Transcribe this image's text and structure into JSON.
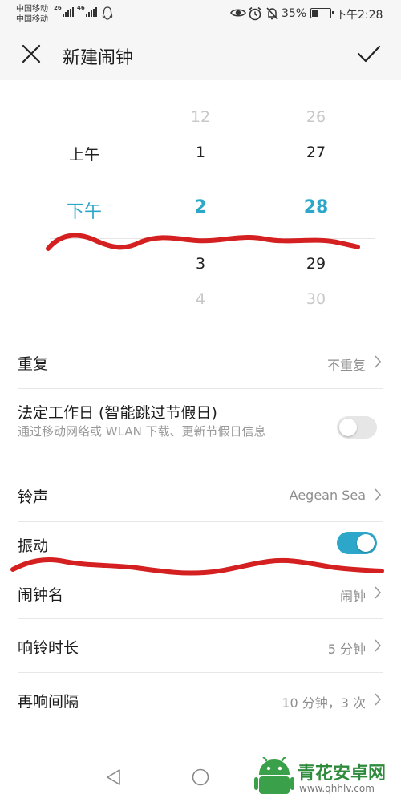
{
  "status_bar": {
    "carrier1": "中国移动",
    "carrier2": "中国移动",
    "net1": "26",
    "net2": "46",
    "battery_percent": "35%",
    "battery_level": 0.35,
    "time": "下午2:28",
    "icons": [
      "signal-icon",
      "qq-icon",
      "eye-icon",
      "alarm-icon",
      "mute-icon",
      "battery-icon"
    ]
  },
  "header": {
    "title": "新建闹钟",
    "close_icon": "close-icon",
    "confirm_icon": "check-icon"
  },
  "time_picker": {
    "period_column": {
      "above": "上午",
      "selected": "下午"
    },
    "hour_column": {
      "above2": "12",
      "above1": "1",
      "selected": "2",
      "below1": "3",
      "below2": "4"
    },
    "minute_column": {
      "above2": "26",
      "above1": "27",
      "selected": "28",
      "below1": "29",
      "below2": "30"
    }
  },
  "settings": {
    "repeat": {
      "label": "重复",
      "value": "不重复"
    },
    "workday": {
      "label": "法定工作日 (智能跳过节假日)",
      "subtitle": "通过移动网络或 WLAN 下载、更新节假日信息",
      "enabled": false
    },
    "ringtone": {
      "label": "铃声",
      "value": "Aegean Sea"
    },
    "vibrate": {
      "label": "振动",
      "enabled": true
    },
    "alarm_name": {
      "label": "闹钟名",
      "value": "闹钟"
    },
    "ring_duration": {
      "label": "响铃时长",
      "value": "5 分钟"
    },
    "snooze_interval": {
      "label": "再响间隔",
      "value": "10 分钟，3 次"
    }
  },
  "nav_bar": {
    "icons": [
      "back-icon",
      "home-icon"
    ]
  },
  "watermark": {
    "text": "青花安卓网",
    "url": "www.qhhlv.com"
  },
  "colors": {
    "accent": "#2ca7c9",
    "scribble": "#d42020",
    "watermark_green": "#2e8b3c"
  }
}
